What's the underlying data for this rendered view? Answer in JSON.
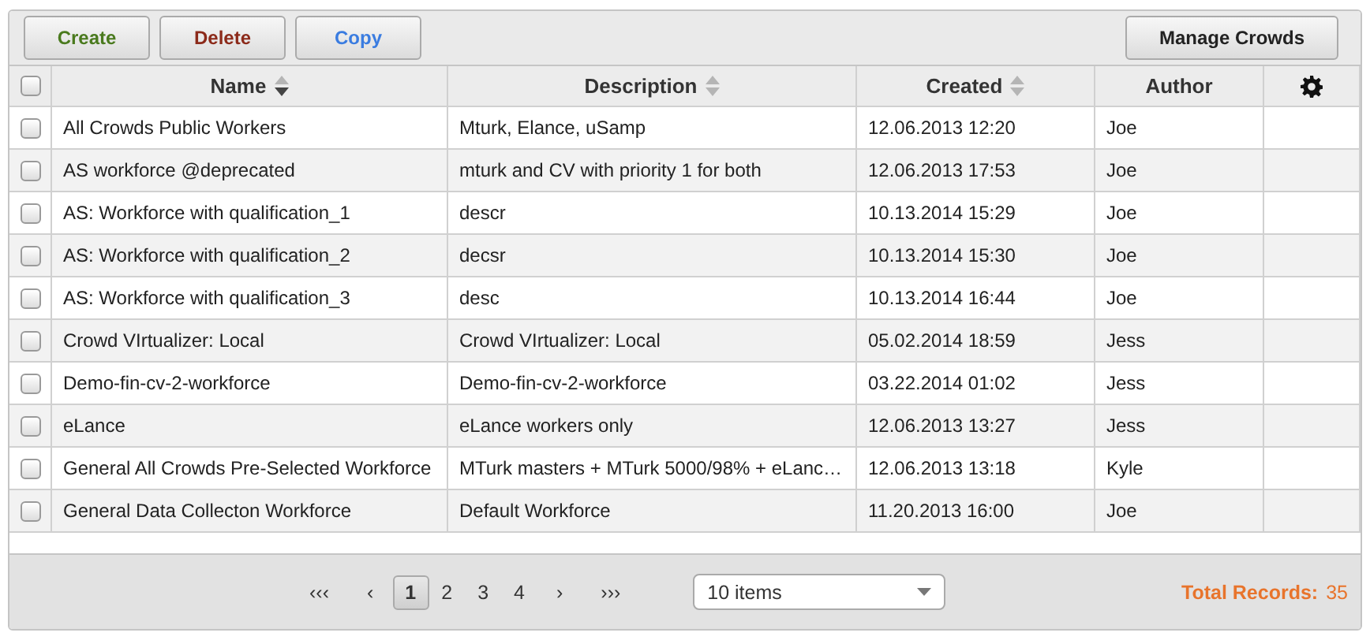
{
  "toolbar": {
    "buttons": [
      {
        "label": "Create",
        "kind": "create"
      },
      {
        "label": "Delete",
        "kind": "delete"
      },
      {
        "label": "Copy",
        "kind": "copy"
      }
    ],
    "manage_button": "Manage Crowds"
  },
  "table": {
    "select_all": {
      "checked": false
    },
    "columns": [
      {
        "label": "Name",
        "sorted": true
      },
      {
        "label": "Description",
        "sorted": false
      },
      {
        "label": "Created",
        "sorted": false
      },
      {
        "label": "Author"
      }
    ],
    "rows": [
      {
        "checked": false,
        "cells": [
          "All Crowds Public Workers",
          "Mturk, Elance, uSamp",
          "12.06.2013 12:20",
          "Joe"
        ]
      },
      {
        "checked": false,
        "cells": [
          "AS workforce @deprecated",
          "mturk and CV with priority 1 for both",
          "12.06.2013 17:53",
          "Joe"
        ]
      },
      {
        "checked": false,
        "cells": [
          "AS: Workforce with qualification_1",
          "descr",
          "10.13.2014 15:29",
          "Joe"
        ]
      },
      {
        "checked": false,
        "cells": [
          "AS: Workforce with qualification_2",
          "decsr",
          "10.13.2014 15:30",
          "Joe"
        ]
      },
      {
        "checked": false,
        "cells": [
          "AS: Workforce with qualification_3",
          "desc",
          "10.13.2014 16:44",
          "Joe"
        ]
      },
      {
        "checked": false,
        "cells": [
          "Crowd VIrtualizer: Local",
          "Crowd VIrtualizer: Local",
          "05.02.2014 18:59",
          "Jess"
        ]
      },
      {
        "checked": false,
        "cells": [
          "Demo-fin-cv-2-workforce",
          "Demo-fin-cv-2-workforce",
          "03.22.2014 01:02",
          "Jess"
        ]
      },
      {
        "checked": false,
        "cells": [
          "eLance",
          "eLance workers only",
          "12.06.2013 13:27",
          "Jess"
        ]
      },
      {
        "checked": false,
        "cells": [
          "General All Crowds Pre-Selected Workforce",
          "MTurk masters + MTurk 5000/98% + eLanc…",
          "12.06.2013 13:18",
          "Kyle"
        ]
      },
      {
        "checked": false,
        "cells": [
          "General Data Collecton Workforce",
          "Default Workforce",
          "11.20.2013 16:00",
          "Joe"
        ]
      }
    ]
  },
  "pager": {
    "first": "‹‹‹",
    "prev": "‹",
    "pages": [
      {
        "label": "1",
        "selected": true
      },
      {
        "label": "2",
        "selected": false
      },
      {
        "label": "3",
        "selected": false
      },
      {
        "label": "4",
        "selected": false
      }
    ],
    "next": "›",
    "last": "›››",
    "page_size": "10 items",
    "total_label": "Total Records:",
    "total_value": "35"
  }
}
